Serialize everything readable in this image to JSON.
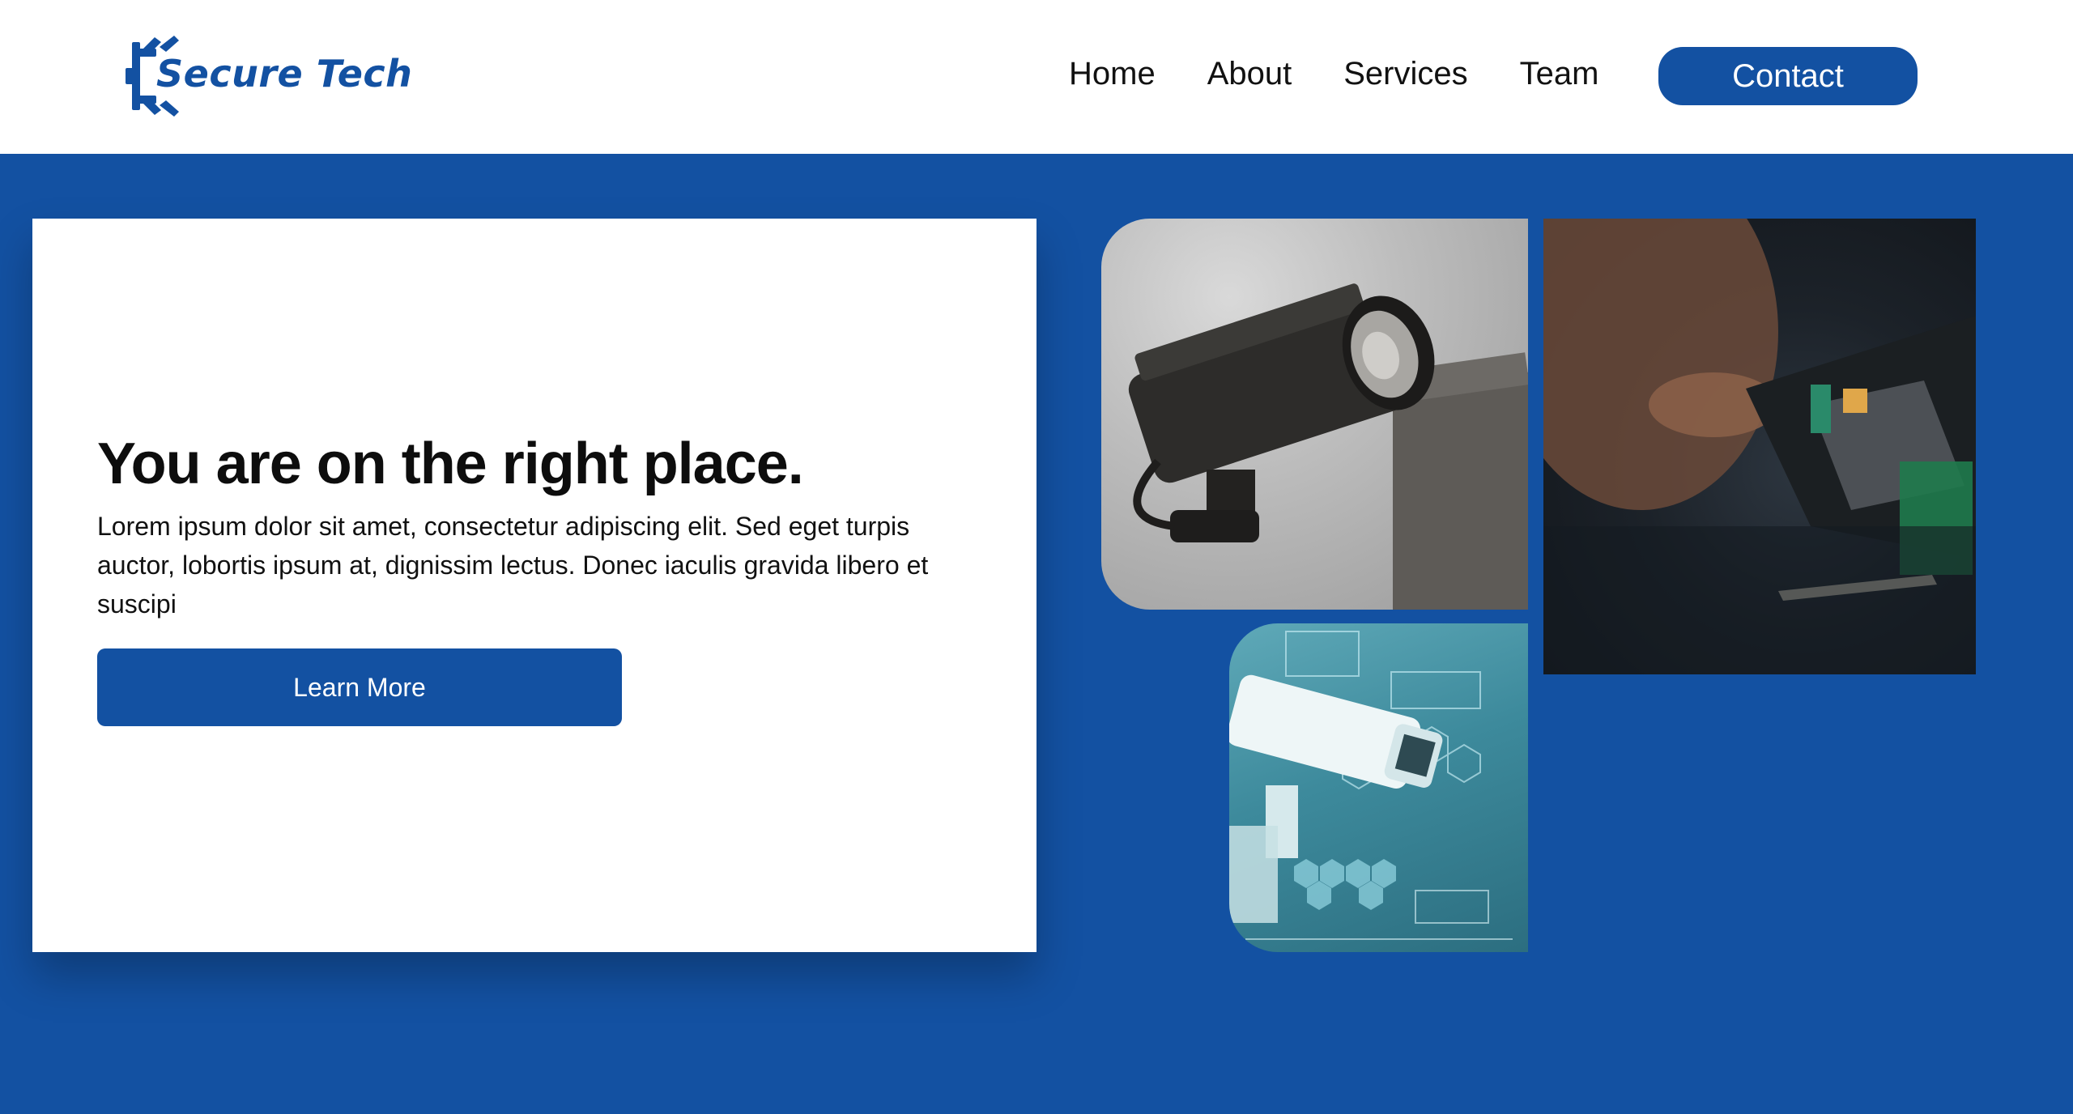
{
  "brand": {
    "logo_text": "Secure Tech",
    "color": "#1351a2"
  },
  "nav": {
    "items": [
      {
        "label": "Home"
      },
      {
        "label": "About"
      },
      {
        "label": "Services"
      },
      {
        "label": "Team"
      }
    ],
    "contact_label": "Contact"
  },
  "hero": {
    "title": "You are on the right place.",
    "text": "Lorem ipsum dolor sit amet, consectetur adipiscing elit. Sed eget turpis auctor, lobortis ipsum at, dignissim lectus. Donec iaculis gravida libero et suscipi",
    "button_label": "Learn More"
  },
  "images": [
    {
      "subject": "cctv-camera-photo"
    },
    {
      "subject": "electronics-repair-photo"
    },
    {
      "subject": "surveillance-camera-digital-photo"
    }
  ],
  "colors": {
    "background": "#1351a2",
    "card": "#ffffff",
    "button": "#1351a2"
  }
}
